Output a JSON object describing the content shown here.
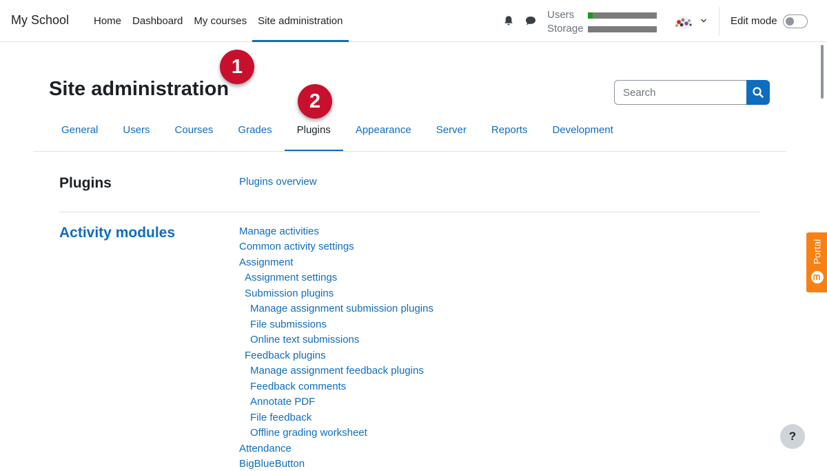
{
  "brand": "My School",
  "nav": {
    "items": [
      "Home",
      "Dashboard",
      "My courses",
      "Site administration"
    ],
    "active": "Site administration"
  },
  "quota": {
    "users_label": "Users",
    "storage_label": "Storage",
    "users_used_fraction": 0.07,
    "storage_used_fraction": 0.0
  },
  "edit_mode": {
    "label": "Edit mode",
    "enabled": false
  },
  "page": {
    "title": "Site administration"
  },
  "search": {
    "placeholder": "Search"
  },
  "tabs": {
    "items": [
      "General",
      "Users",
      "Courses",
      "Grades",
      "Plugins",
      "Appearance",
      "Server",
      "Reports",
      "Development"
    ],
    "active": "Plugins"
  },
  "sections": {
    "plugins": {
      "title": "Plugins",
      "links": [
        "Plugins overview"
      ]
    },
    "activity_modules": {
      "title": "Activity modules",
      "links": [
        "Manage activities",
        "Common activity settings",
        "Assignment",
        "Assignment settings",
        "Submission plugins",
        "Manage assignment submission plugins",
        "File submissions",
        "Online text submissions",
        "Feedback plugins",
        "Manage assignment feedback plugins",
        "Feedback comments",
        "Annotate PDF",
        "File feedback",
        "Offline grading worksheet",
        "Attendance",
        "BigBlueButton"
      ]
    }
  },
  "badges": [
    "1",
    "2"
  ],
  "portal": {
    "label": "Portal"
  },
  "help": {
    "label": "?"
  },
  "colors": {
    "link": "#0f6cbf",
    "badge": "#c8102e",
    "portal": "#f98012",
    "quota_used": "#1a9a1a",
    "quota_free": "#7b7b7b"
  },
  "icons": {
    "notifications": "bell-icon",
    "messages": "chat-bubble-icon",
    "search": "search-icon",
    "user_menu": "chevron-down-icon"
  }
}
